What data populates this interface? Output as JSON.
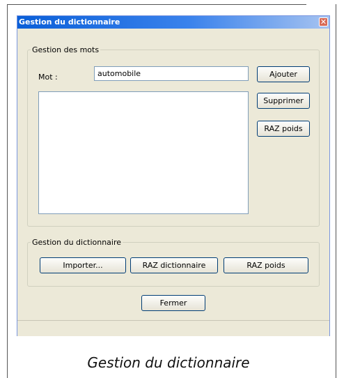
{
  "window": {
    "title": "Gestion du dictionnaire",
    "close_glyph": "✕"
  },
  "words_group": {
    "legend": "Gestion des mots",
    "word_label": "Mot :",
    "word_value": "automobile",
    "add_label": "Ajouter",
    "delete_label": "Supprimer",
    "reset_weights_label": "RAZ poids"
  },
  "dictionary_group": {
    "legend": "Gestion du dictionnaire",
    "import_label": "Importer...",
    "reset_dictionary_label": "RAZ dictionnaire",
    "reset_weights_label": "RAZ poids"
  },
  "close_button_label": "Fermer",
  "caption": "Gestion du dictionnaire"
}
